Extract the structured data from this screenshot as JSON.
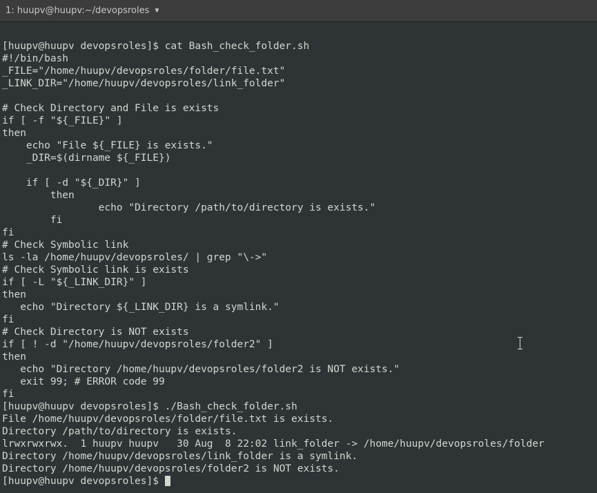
{
  "titlebar": {
    "label": "1: huupv@huupv:~/devopsroles"
  },
  "lines": [
    "[huupv@huupv devopsroles]$ cat Bash_check_folder.sh",
    "#!/bin/bash",
    "_FILE=\"/home/huupv/devopsroles/folder/file.txt\"",
    "_LINK_DIR=\"/home/huupv/devopsroles/link_folder\"",
    "",
    "# Check Directory and File is exists",
    "if [ -f \"${_FILE}\" ]",
    "then",
    "    echo \"File ${_FILE} is exists.\"",
    "    _DIR=$(dirname ${_FILE})",
    "",
    "    if [ -d \"${_DIR}\" ]",
    "        then",
    "                echo \"Directory /path/to/directory is exists.\"",
    "        fi",
    "fi",
    "# Check Symbolic link",
    "ls -la /home/huupv/devopsroles/ | grep \"\\->\"",
    "# Check Symbolic link is exists",
    "if [ -L \"${_LINK_DIR}\" ]",
    "then",
    "   echo \"Directory ${_LINK_DIR} is a symlink.\"",
    "fi",
    "# Check Directory is NOT exists",
    "if [ ! -d \"/home/huupv/devopsroles/folder2\" ]",
    "then",
    "   echo \"Directory /home/huupv/devopsroles/folder2 is NOT exists.\"",
    "   exit 99; # ERROR code 99",
    "fi",
    "[huupv@huupv devopsroles]$ ./Bash_check_folder.sh",
    "File /home/huupv/devopsroles/folder/file.txt is exists.",
    "Directory /path/to/directory is exists.",
    "lrwxrwxrwx.  1 huupv huupv   30 Aug  8 22:02 link_folder -> /home/huupv/devopsroles/folder",
    "Directory /home/huupv/devopsroles/link_folder is a symlink.",
    "Directory /home/huupv/devopsroles/folder2 is NOT exists.",
    "[huupv@huupv devopsroles]$ "
  ]
}
